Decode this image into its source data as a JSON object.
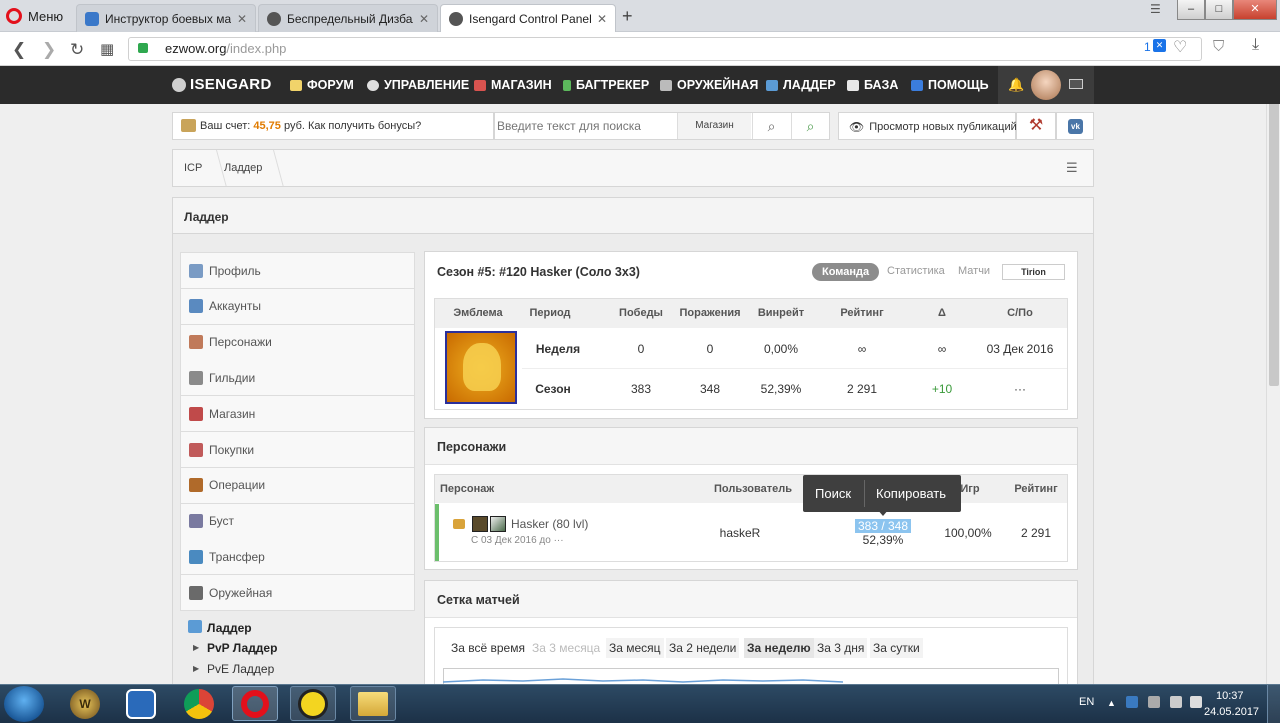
{
  "browser": {
    "menu_label": "Меню",
    "tabs": [
      {
        "title": "Инструктор боевых маго",
        "fav_color": "#3a78c9"
      },
      {
        "title": "Беспредельный Дизбала",
        "fav_color": "#555555"
      },
      {
        "title": "Isengard Control Panel",
        "fav_color": "#555555"
      }
    ],
    "url_domain": "ezwow.org",
    "url_path": "/index.php",
    "badge_count": "1"
  },
  "site": {
    "brand": "ISENGARD",
    "nav": [
      "ФОРУМ",
      "УПРАВЛЕНИЕ",
      "МАГАЗИН",
      "БАГТРЕКЕР",
      "ОРУЖЕЙНАЯ",
      "ЛАДДЕР",
      "БАЗА",
      "ПОМОЩЬ"
    ]
  },
  "toolbar": {
    "account_prefix": "Ваш счет:",
    "account_value": "45,75",
    "account_suffix": "руб. Как получить бонусы?",
    "search_placeholder": "Введите текст для поиска",
    "search_scope": "Магазин",
    "new_pubs": "Просмотр новых публикаций"
  },
  "breadcrumb": [
    "ICP",
    "Ладдер"
  ],
  "page_title": "Ладдер",
  "sidebar": [
    {
      "label": "Профиль",
      "color": "#7a9bc4"
    },
    {
      "label": "Аккаунты",
      "color": "#5a8ac0"
    },
    {
      "label": "Персонажи",
      "color": "#c07a5a"
    },
    {
      "label": "Гильдии",
      "color": "#8a8a8a"
    },
    {
      "label": "Магазин",
      "color": "#c04a4a"
    },
    {
      "label": "Покупки",
      "color": "#c05a5a"
    },
    {
      "label": "Операции",
      "color": "#b06a2a"
    },
    {
      "label": "Буст",
      "color": "#7a7aa0"
    },
    {
      "label": "Трансфер",
      "color": "#4a8ac0"
    },
    {
      "label": "Оружейная",
      "color": "#6a6a6a"
    }
  ],
  "sidebar_ladder": {
    "label": "Ладдер",
    "sub": [
      "PvP Ладдер",
      "PvE Ладдер"
    ]
  },
  "season": {
    "title": "Сезон #5: #120 Hasker (Соло 3x3)",
    "tabs": [
      "Команда",
      "Статистика",
      "Матчи"
    ],
    "realm": "Tirion",
    "headers": [
      "Эмблема",
      "Период",
      "Победы",
      "Поражения",
      "Винрейт",
      "Рейтинг",
      "Δ",
      "С/По"
    ],
    "rows": [
      [
        "Неделя",
        "0",
        "0",
        "0,00%",
        "∞",
        "∞",
        "03 Дек 2016"
      ],
      [
        "Сезон",
        "383",
        "348",
        "52,39%",
        "2 291",
        "+10",
        "···"
      ]
    ]
  },
  "characters": {
    "title": "Персонажи",
    "headers": [
      "Персонаж",
      "Пользователь",
      "Игр",
      "Рейтинг"
    ],
    "name": "Hasker (80 lvl)",
    "since": "С 03 Дек 2016 до ···",
    "user": "haskeR",
    "record": "383 / 348",
    "winrate": "52,39%",
    "games_pct": "100,00%",
    "rating": "2 291"
  },
  "context_menu": [
    "Поиск",
    "Копировать"
  ],
  "matches": {
    "title": "Сетка матчей",
    "filters": [
      "За всё время",
      "За 3 месяца",
      "За месяц",
      "За 2 недели",
      "За неделю",
      "За 3 дня",
      "За сутки"
    ]
  },
  "taskbar": {
    "lang": "EN",
    "time": "10:37",
    "date": "24.05.2017"
  }
}
